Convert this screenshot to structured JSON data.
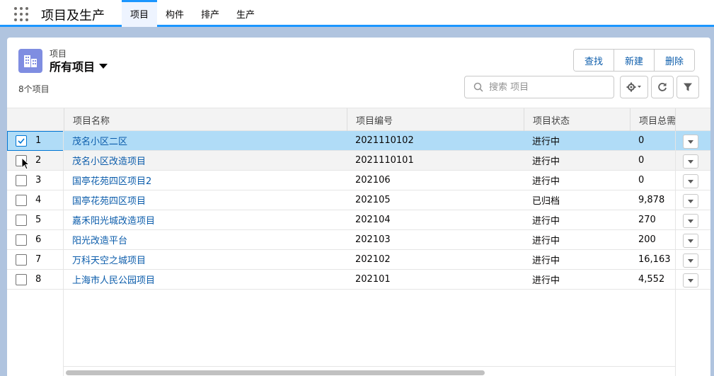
{
  "app": {
    "name": "项目及生产",
    "tabs": [
      {
        "label": "项目",
        "active": true
      },
      {
        "label": "构件",
        "active": false
      },
      {
        "label": "排产",
        "active": false
      },
      {
        "label": "生产",
        "active": false
      }
    ]
  },
  "list_view": {
    "object_label": "项目",
    "title": "所有项目",
    "count_text": "8个项目",
    "icon": "building-icon",
    "buttons": {
      "find": "查找",
      "new": "新建",
      "delete": "删除"
    },
    "search": {
      "placeholder": "搜索 项目",
      "value": ""
    }
  },
  "table": {
    "columns": [
      "项目名称",
      "项目编号",
      "项目状态",
      "项目总需"
    ],
    "rows": [
      {
        "num": "1",
        "name": "茂名小区二区",
        "code": "2021110102",
        "status": "进行中",
        "total": "0",
        "checked": true
      },
      {
        "num": "2",
        "name": "茂名小区改造项目",
        "code": "2021110101",
        "status": "进行中",
        "total": "0",
        "checked": false
      },
      {
        "num": "3",
        "name": "国亭花苑四区项目2",
        "code": "202106",
        "status": "进行中",
        "total": "0",
        "checked": false
      },
      {
        "num": "4",
        "name": "国亭花苑四区项目",
        "code": "202105",
        "status": "已归档",
        "total": "9,878",
        "checked": false
      },
      {
        "num": "5",
        "name": "嘉禾阳光城改造项目",
        "code": "202104",
        "status": "进行中",
        "total": "270",
        "checked": false
      },
      {
        "num": "6",
        "name": "阳光改造平台",
        "code": "202103",
        "status": "进行中",
        "total": "200",
        "checked": false
      },
      {
        "num": "7",
        "name": "万科天空之城项目",
        "code": "202102",
        "status": "进行中",
        "total": "16,163",
        "checked": false
      },
      {
        "num": "8",
        "name": "上海市人民公园项目",
        "code": "202101",
        "status": "进行中",
        "total": "4,552",
        "checked": false
      }
    ]
  },
  "colors": {
    "accent": "#1b96ff",
    "link": "#0b5cab",
    "selected_row": "#b0dcf7",
    "object_icon": "#7f8de1"
  }
}
